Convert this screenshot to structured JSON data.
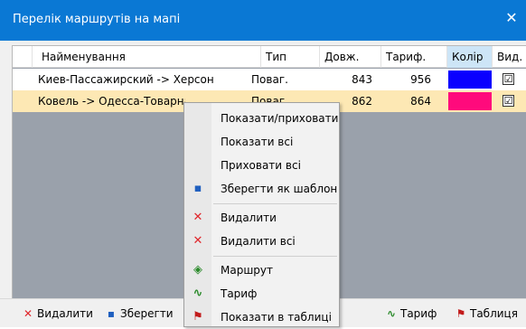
{
  "window": {
    "title": "Перелік маршрутів на мапі",
    "close_icon": "close-icon"
  },
  "table": {
    "columns": [
      "Найменування",
      "Тип",
      "Довж.",
      "Тариф.",
      "Колір",
      "Вид."
    ],
    "rows": [
      {
        "name": "Киев-Пассажирский -> Херсон",
        "type": "Поваг.",
        "length": "843",
        "tariff": "956",
        "color": "#0a00ff",
        "visible": "☑"
      },
      {
        "name": "Ковель -> Одесса-Товарная",
        "type": "Поваг.",
        "length": "862",
        "tariff": "864",
        "color": "#ff0a7c",
        "visible": "☑"
      }
    ]
  },
  "toolbar": {
    "delete_label": "Видалити",
    "save_label": "Зберегти",
    "tariff_label": "Тариф",
    "table_label": "Таблиця"
  },
  "context_menu": {
    "items": [
      {
        "label": "Показати/приховати",
        "icon": ""
      },
      {
        "label": "Показати всі",
        "icon": ""
      },
      {
        "label": "Приховати всі",
        "icon": ""
      },
      {
        "label": "Зберегти як шаблон",
        "icon": "save-icon"
      },
      {
        "label": "Видалити",
        "icon": "delete-icon"
      },
      {
        "label": "Видалити всі",
        "icon": "delete-all-icon"
      },
      {
        "label": "Маршрут",
        "icon": "route-icon"
      },
      {
        "label": "Тариф",
        "icon": "tariff-icon"
      },
      {
        "label": "Показати в таблиці",
        "icon": "table-flag-icon"
      }
    ]
  },
  "colors": {
    "accent": "#0a78d4",
    "selected_row": "#fde8b4",
    "grid_bg": "#9aa1ab"
  }
}
